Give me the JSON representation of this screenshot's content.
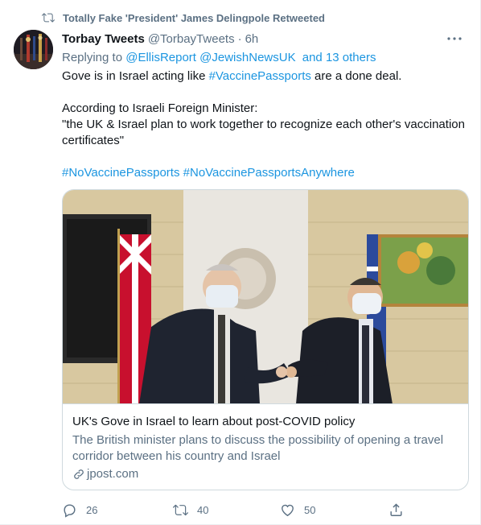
{
  "retweet": {
    "label": "Totally Fake 'President' James Delingpole Retweeted",
    "icon": "retweet-icon"
  },
  "tweet": {
    "name": "Torbay Tweets",
    "handle": "@TorbayTweets",
    "separator": "·",
    "time": "6h",
    "replying_prefix": "Replying to",
    "replying_to": [
      "@EllisReport",
      "@JewishNewsUK"
    ],
    "replying_others": "and 13 others",
    "line1_pre": "Gove is in Israel acting like ",
    "line1_tag": "#VaccinePassports",
    "line1_post": " are a done deal.",
    "line2": "According to Israeli Foreign Minister:",
    "line3": "\"the UK & Israel plan to work together to recognize each other's vaccination certificates\"",
    "hashtags": [
      "#NoVaccinePassports",
      "#NoVaccinePassportsAnywhere"
    ]
  },
  "card": {
    "title": "UK's Gove in Israel to learn about post-COVID policy",
    "description": "The British minister plans to discuss the possibility of opening a travel corridor between his country and Israel",
    "domain": "jpost.com"
  },
  "actions": {
    "reply_count": "26",
    "retweet_count": "40",
    "like_count": "50"
  },
  "colors": {
    "link": "#1b95e0",
    "muted": "#5b7083",
    "text": "#0f1419",
    "border": "#cfd9de"
  }
}
